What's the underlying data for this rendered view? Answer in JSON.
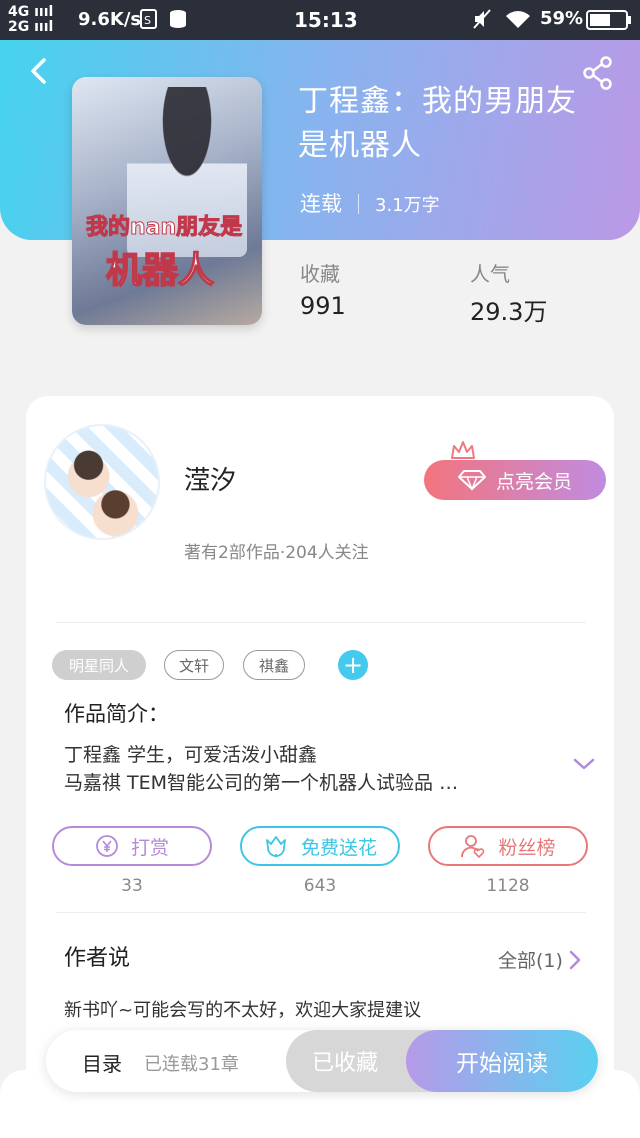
{
  "status_bar": {
    "network_line1": "4G",
    "network_line2": "2G",
    "speed": "9.6K/s",
    "time": "15:13",
    "battery": "59%"
  },
  "book": {
    "title": "丁程鑫：我的男朋友是机器人",
    "status": "连载",
    "word_count": "3.1万字",
    "cover_text_line1": "我的nan朋友是",
    "cover_text_line2": "机器人",
    "favorites_label": "收藏",
    "favorites_value": "991",
    "popularity_label": "人气",
    "popularity_value": "29.3万"
  },
  "author": {
    "name": "滢汐",
    "stats": "著有2部作品·204人关注",
    "vip_button": "点亮会员"
  },
  "tags": [
    "明星同人",
    "文轩",
    "祺鑫"
  ],
  "intro": {
    "title": "作品简介：",
    "line1": "丁程鑫 学生，可爱活泼小甜鑫",
    "line2": "马嘉祺 TEM智能公司的第一个机器人试验品 …"
  },
  "actions": [
    {
      "label": "打赏",
      "count": "33",
      "color": "#b48ad9",
      "icon": "yen-coin-icon"
    },
    {
      "label": "免费送花",
      "count": "643",
      "color": "#3cc6e3",
      "icon": "flower-icon"
    },
    {
      "label": "粉丝榜",
      "count": "1128",
      "color": "#e87878",
      "icon": "fan-user-icon"
    }
  ],
  "author_say": {
    "title": "作者说",
    "all_link": "全部(1)",
    "text": "新书吖~可能会写的不太好，欢迎大家提建议"
  },
  "bottom_bar": {
    "toc": "目录",
    "toc_sub": "已连载31章",
    "collected": "已收藏",
    "start_read": "开始阅读"
  },
  "colors": {
    "header_gradient": [
      "#45d3ee",
      "#bb99e6"
    ],
    "vip_gradient": [
      "#f3747d",
      "#c08ce0"
    ],
    "accent_cyan": "#45c9ee"
  }
}
